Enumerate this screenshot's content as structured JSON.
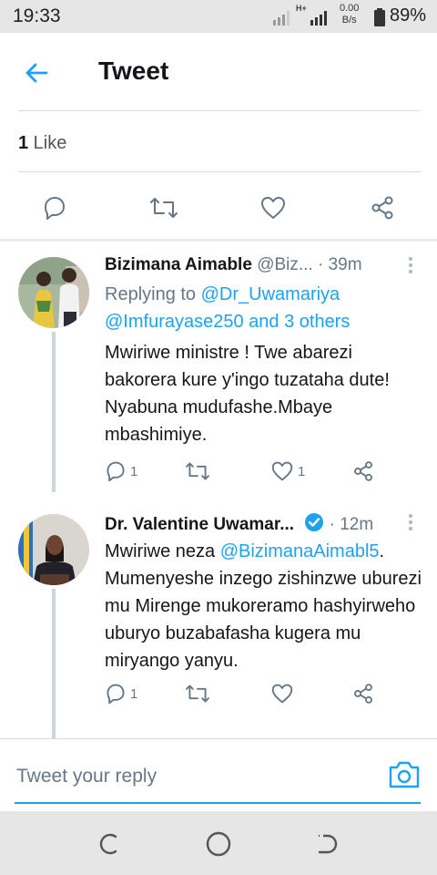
{
  "status_bar": {
    "time": "19:33",
    "network_type": "H+",
    "speed_value": "0.00",
    "speed_unit": "B/s",
    "battery": "89%"
  },
  "header": {
    "title": "Tweet",
    "back_icon": "arrow-left-icon"
  },
  "likes": {
    "count": "1",
    "label": " Like"
  },
  "action_bar": {
    "icons": [
      "reply-icon",
      "retweet-icon",
      "like-icon",
      "share-icon"
    ]
  },
  "replies": [
    {
      "name": "Bizimana Aimable",
      "handle": "@Biz...",
      "time": "· 39m",
      "replying_prefix": "Replying to ",
      "replying_link1": "@Dr_Uwamariya",
      "replying_link2": "@Imfurayase250 and 3 others",
      "text": "Mwiriwe ministre ! Twe abarezi bakorera kure y'ingo tuzataha dute! Nyabuna mudufashe.Mbaye mbashimiye.",
      "reply_count": "1",
      "like_count": "1"
    },
    {
      "name": "Dr. Valentine Uwamar...",
      "verified": true,
      "time": "· 12m",
      "text_prefix": "Mwiriwe neza ",
      "text_mention": "@BizimanaAimabl5",
      "text_rest": ". Mumenyeshe inzego zishinzwe uburezi mu Mirenge mukoreramo hashyirweho uburyo buzabafasha kugera mu miryango yanyu.",
      "reply_count": "1"
    }
  ],
  "reply_bar": {
    "placeholder": "Tweet your reply",
    "camera_icon": "camera-icon"
  },
  "colors": {
    "accent": "#1da1f2",
    "text": "#14171a",
    "muted": "#657786"
  }
}
